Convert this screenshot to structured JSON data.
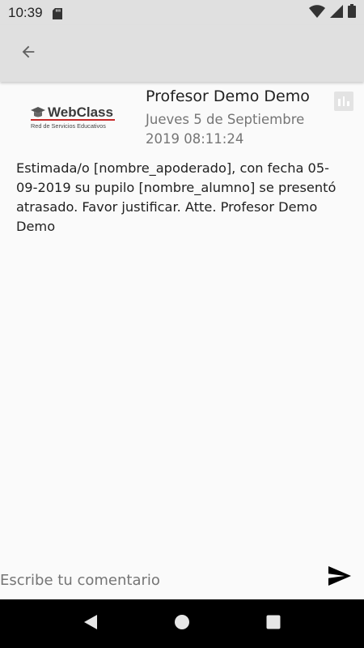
{
  "status_bar": {
    "time": "10:39",
    "icons": [
      "sd-card-icon",
      "wifi-icon",
      "signal-icon",
      "battery-icon"
    ]
  },
  "app_bar": {
    "back_icon": "arrow-back-icon"
  },
  "notification": {
    "logo_text": "WebClass",
    "logo_tagline": "Red de Servicios Educativos",
    "author": "Profesor Demo Demo",
    "date": "Jueves 5 de Septiembre 2019 08:11:24",
    "stats_icon": "bar-chart-icon",
    "message": "Estimada/o [nombre_apoderado], con fecha 05-09-2019 su pupilo [nombre_alumno] se presentó atrasado. Favor justificar. Atte. Profesor Demo Demo"
  },
  "comment": {
    "placeholder": "Escribe tu comentario",
    "value": "",
    "send_icon": "send-icon"
  },
  "nav_bar": {
    "icons": [
      "back-triangle-icon",
      "home-circle-icon",
      "recents-square-icon"
    ]
  },
  "colors": {
    "bar_background": "#e0e0e0",
    "page_background": "#fafafa",
    "secondary_text": "#757575",
    "logo_red": "#c62828"
  }
}
